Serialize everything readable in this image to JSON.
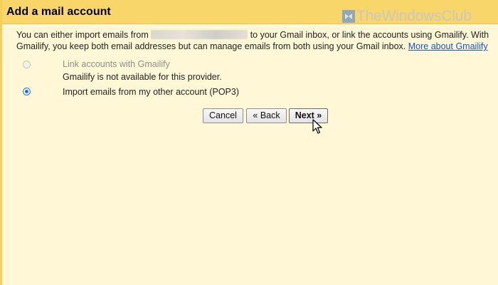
{
  "header": {
    "title": "Add a mail account",
    "watermark": "TheWindowsClub"
  },
  "description": {
    "line1_before": "You can either import emails from",
    "line1_after": "to your Gmail inbox, or link the accounts using Gmailify. With",
    "line2_text": "Gmailify, you keep both email addresses but can manage emails from both using your Gmail inbox.",
    "more_link": "More about Gmailify"
  },
  "options": {
    "gmailify_label": "Link accounts with Gmailify",
    "gmailify_note": "Gmailify is not available for this provider.",
    "pop3_label": "Import emails from my other account (POP3)",
    "selected": "pop3"
  },
  "buttons": {
    "cancel": "Cancel",
    "back": "« Back",
    "next": "Next »"
  },
  "colors": {
    "header_bg": "#f9d66a",
    "body_bg": "#fff7d6",
    "link": "#1155cc",
    "radio_selected": "#1a73e8"
  }
}
